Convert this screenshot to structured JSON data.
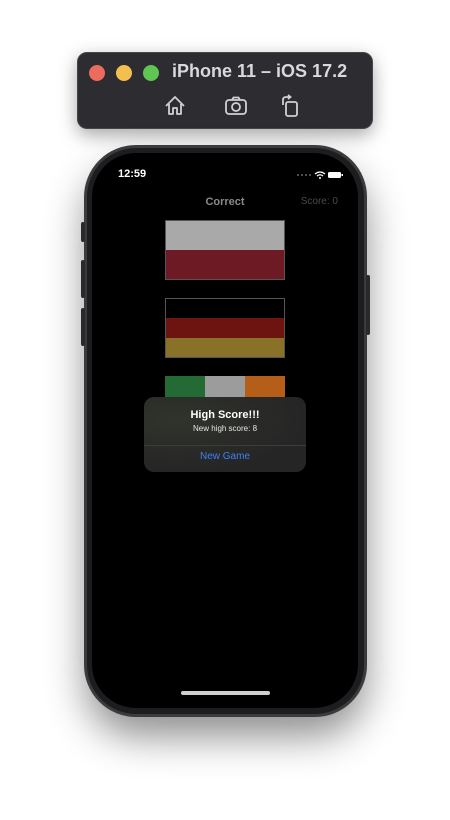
{
  "simulator": {
    "title": "iPhone 11 – iOS 17.2",
    "tools": [
      "home-icon",
      "screenshot-icon",
      "rotate-icon"
    ]
  },
  "status_bar": {
    "time": "12:59"
  },
  "nav": {
    "title": "Correct",
    "score": "Score: 0"
  },
  "flags": [
    {
      "stripes": "horizontal",
      "colors": [
        "#a9a9a9",
        "#6e1a24"
      ]
    },
    {
      "stripes": "horizontal",
      "colors": [
        "#000000",
        "#6d1310",
        "#8a7128"
      ]
    },
    {
      "stripes": "vertical",
      "colors": [
        "#246a35",
        "#9c9c9c",
        "#b45e19"
      ]
    }
  ],
  "alert": {
    "title": "High Score!!!",
    "message": "New high score: 8",
    "button": "New Game"
  }
}
